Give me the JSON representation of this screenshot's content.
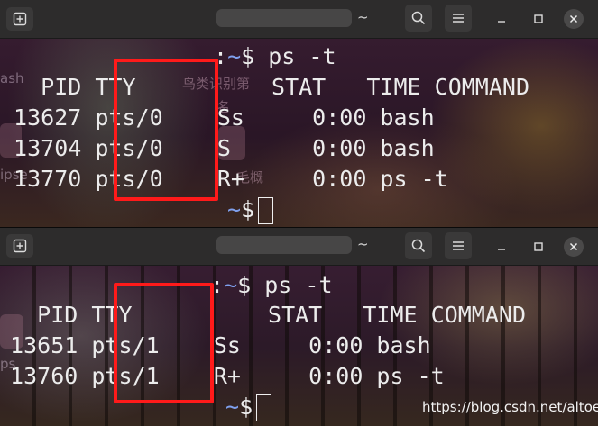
{
  "colors": {
    "prompt_tilde": "#7fa0ee",
    "highlight": "#ff1a1a",
    "titlebar": "#2d2c2c"
  },
  "icons": {
    "new_tab": "new-tab-icon",
    "search": "search-icon",
    "menu": "hamburger-menu-icon",
    "minimize": "minimize-icon",
    "maximize": "maximize-icon",
    "close": "close-icon"
  },
  "windows": [
    {
      "title": "~",
      "prompt_suffix": ":",
      "tilde": "~",
      "dollar": "$",
      "command": " ps -t",
      "header": "   PID TTY          STAT   TIME COMMAND",
      "rows": [
        " 13627 pts/0    Ss     0:00 bash",
        " 13704 pts/0    S      0:00 bash",
        " 13770 pts/0    R+     0:00 ps -t"
      ]
    },
    {
      "title": "~",
      "prompt_suffix": ":",
      "tilde": "~",
      "dollar": "$",
      "command": " ps -t",
      "header": "   PID TTY          STAT   TIME COMMAND",
      "rows": [
        " 13651 pts/1    Ss     0:00 bash",
        " 13760 pts/1    R+     0:00 ps -t"
      ]
    }
  ],
  "ghost_labels": {
    "g1": "ash",
    "g2": "ipse",
    "g3": "ps",
    "c1": "鸟类识别第",
    "c2": "名",
    "c3": "毛概"
  },
  "watermark": "https://blog.csdn.net/altoer"
}
